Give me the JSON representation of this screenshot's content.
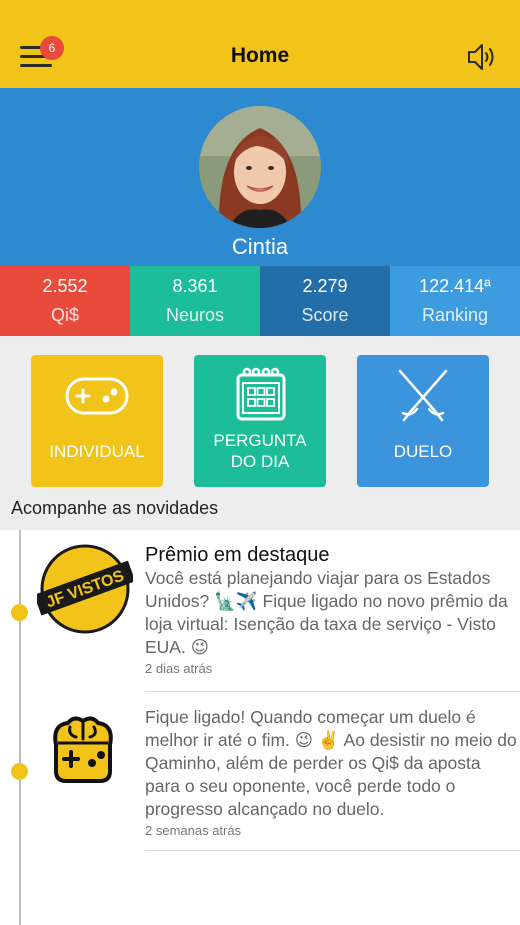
{
  "header": {
    "title": "Home",
    "notification_count": "6",
    "menu_icon": "hamburger-menu-icon",
    "sound_icon": "speaker-icon"
  },
  "profile": {
    "name": "Cintia"
  },
  "stats": [
    {
      "value": "2.552",
      "label": "Qi$",
      "color": "#E84B3C"
    },
    {
      "value": "8.361",
      "label": "Neuros",
      "color": "#1DBD9A"
    },
    {
      "value": "2.279",
      "label": "Score",
      "color": "#236DA8"
    },
    {
      "value": "122.414ª",
      "label": "Ranking",
      "color": "#3D9BE0"
    }
  ],
  "modes": [
    {
      "label_line1": "INDIVIDUAL",
      "label_line2": "",
      "icon": "gamepad-icon"
    },
    {
      "label_line1": "PERGUNTA",
      "label_line2": "DO DIA",
      "icon": "calendar-icon"
    },
    {
      "label_line1": "DUELO",
      "label_line2": "",
      "icon": "crossed-swords-icon"
    }
  ],
  "feed": {
    "section_title": "Acompanhe as novidades",
    "posts": [
      {
        "title": "Prêmio em destaque",
        "body": "Você está planejando viajar para os Estados Unidos? 🗽✈️ Fique ligado no novo prêmio da loja virtual: Isenção da taxa de serviço - Visto EUA. 😉",
        "time": "2 dias atrás",
        "thumb_text": "JF VISTOS"
      },
      {
        "title": "",
        "body": "Fique ligado! Quando começar um duelo é melhor ir até o fim. 😉 ✌️ Ao desistir no meio do Qaminho, além de perder os Qi$ da aposta para o seu oponente, você perde todo o progresso alcançado no duelo.",
        "time": "2 semanas atrás",
        "thumb_text": ""
      }
    ]
  },
  "colors": {
    "header": "#F2C41A",
    "profile_bg": "#2D8AD0",
    "accent_yellow": "#F2C41A",
    "accent_teal": "#1DBD9A",
    "accent_blue": "#3B94DC",
    "badge": "#E84B3C"
  }
}
